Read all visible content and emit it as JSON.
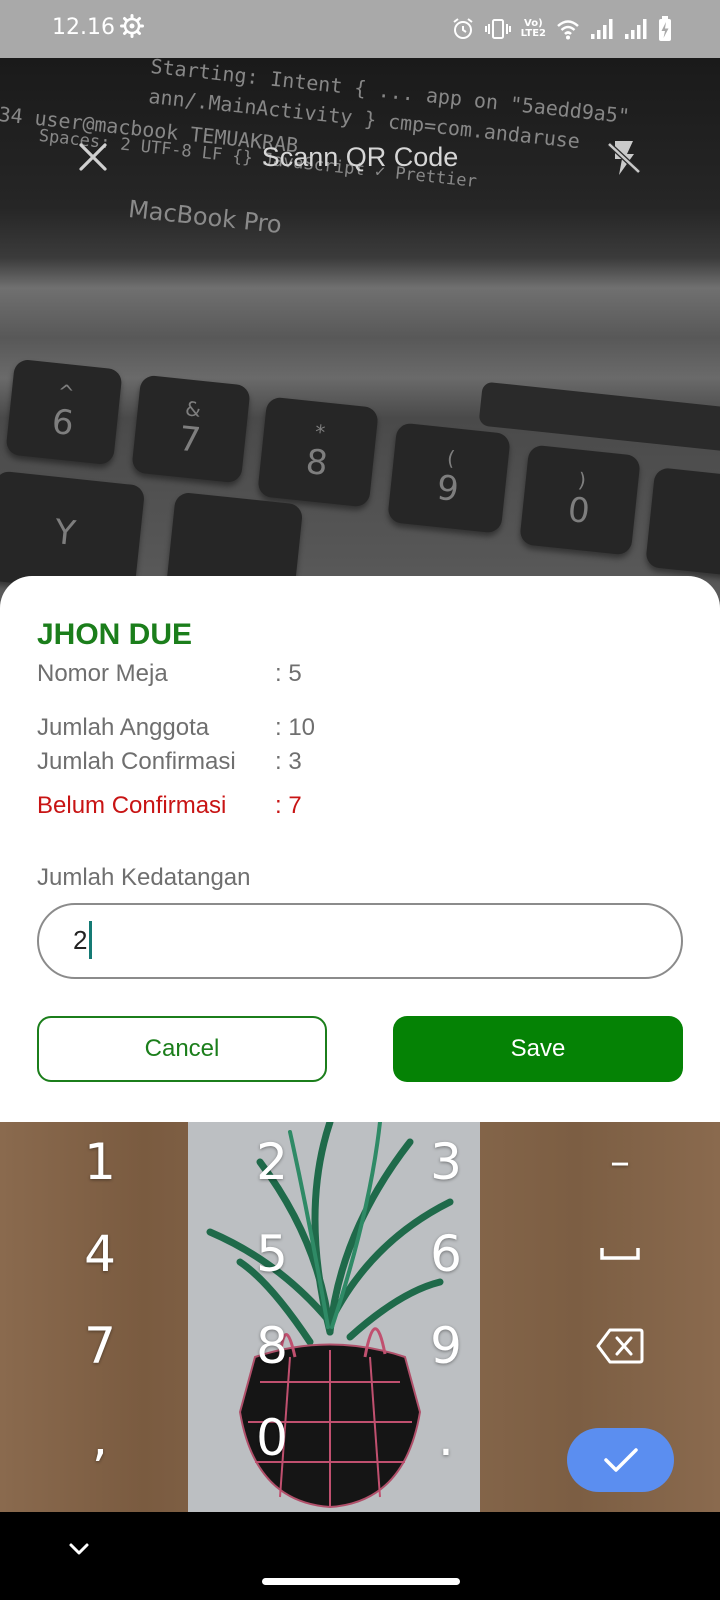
{
  "status_bar": {
    "time": "12.16",
    "volte_label_1": "Vo)",
    "volte_label_2": "LTE2"
  },
  "camera": {
    "title": "Scann QR Code",
    "screen_lines": [
      "Starting: Intent { ... app on \"5aedd9a5\"",
      "ann/.MainActivity }  cmp=com.andaruse",
      "34  user@macbook TEMUAKRAB",
      "Spaces: 2   UTF-8   LF   {} JavaScript   ✓ Prettier"
    ],
    "laptop_brand": "MacBook Pro",
    "keys": [
      {
        "top": "^",
        "bottom": "6"
      },
      {
        "top": "&",
        "bottom": "7"
      },
      {
        "top": "*",
        "bottom": "8"
      },
      {
        "top": "(",
        "bottom": "9"
      },
      {
        "top": ")",
        "bottom": "0"
      },
      {
        "top": "",
        "bottom": "Y"
      }
    ]
  },
  "dialog": {
    "name": "JHON DUE",
    "rows": [
      {
        "label": "Nomor Meja",
        "value": ": 5"
      },
      {
        "label": "Jumlah Anggota",
        "value": ": 10"
      },
      {
        "label": "Jumlah Confirmasi",
        "value": ": 3"
      },
      {
        "label": "Belum Confirmasi",
        "value": ": 7"
      }
    ],
    "field_label": "Jumlah Kedatangan",
    "field_value": "2",
    "cancel_label": "Cancel",
    "save_label": "Save"
  },
  "keyboard": {
    "keys": [
      "1",
      "2",
      "3",
      "–",
      "4",
      "5",
      "6",
      "␣",
      "7",
      "8",
      "9",
      "⌫",
      ",",
      "0",
      "."
    ],
    "done_icon": "check-icon"
  },
  "colors": {
    "accent_green": "#058205",
    "name_green": "#1b7e1b",
    "warning_red": "#c81414",
    "done_blue": "#5b8ef0"
  }
}
